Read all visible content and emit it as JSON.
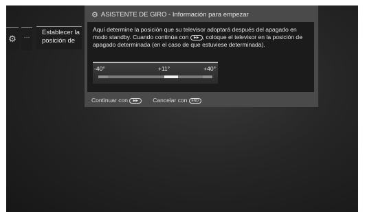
{
  "menu": {
    "gear_icon": "⚙",
    "dots": "···",
    "item_label_line1": "Establecer la",
    "item_label_line2": "posición de"
  },
  "dialog": {
    "title": "ASISTENTE DE GIRO - Información para empezar",
    "title_icon": "gears-icon",
    "body_part1": "Aquí determine la posición que su televisor adoptará después del apagado en modo standby. Cuando continúa con",
    "body_part2": ", coloque el televisor en la posición de apagado determinada (en el caso de que estuviese determinada).",
    "play_button_glyph": "▶▶",
    "slider": {
      "min_label": "-40°",
      "current_label": "+11°",
      "max_label": "+40°",
      "min": -40,
      "max": 40,
      "value": 11
    },
    "footer": {
      "continue_label": "Continuar con",
      "continue_glyph": "▶▶",
      "cancel_label": "Cancelar con",
      "cancel_glyph": "END"
    }
  },
  "colors": {
    "dialog_bg": "#4a4a4a",
    "body_bg": "#1b1b1b",
    "knob": "#f2f2f2"
  }
}
